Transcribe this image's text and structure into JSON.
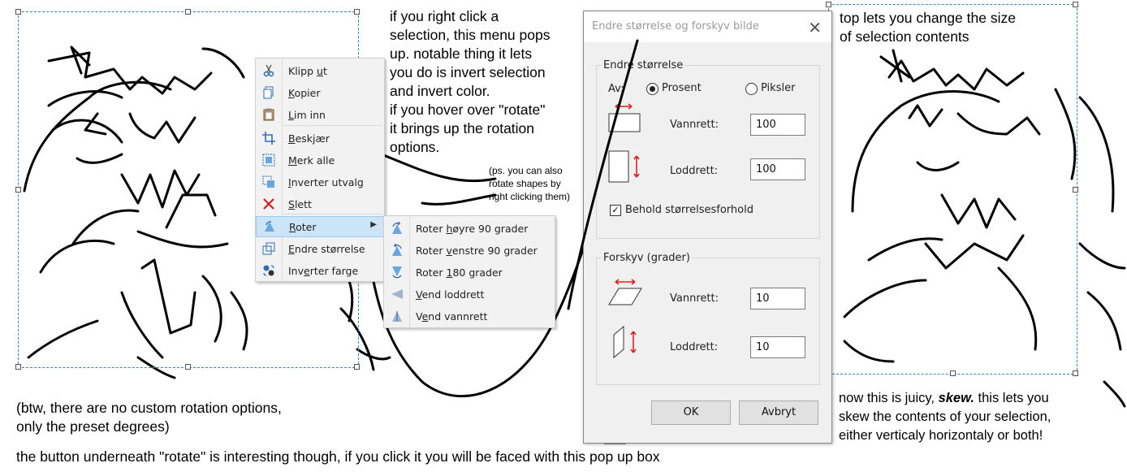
{
  "notes": {
    "right_click": [
      "if you right click a",
      "selection, this menu pops",
      "up. notable thing it lets",
      "you do is invert selection",
      "and invert color.",
      "if you hover over \"rotate\"",
      "it brings up the rotation",
      "options."
    ],
    "ps": [
      "(ps. you can also",
      "rotate shapes by",
      "right clicking them)"
    ],
    "top": [
      "top lets you change the size",
      "of selection contents"
    ],
    "skew_pre": "now this is juicy,",
    "skew_bold": "skew.",
    "skew_post": "this lets you",
    "skew_lines": [
      "skew the contents of your selection,",
      "either verticaly horizontaly or both!"
    ],
    "btw": [
      "(btw, there are no custom rotation options,",
      "only the preset degrees)"
    ],
    "bottom": "the button underneath \"rotate\" is interesting though, if you click it you will be faced with this pop up box"
  },
  "context_menu": {
    "items": [
      {
        "pre": "Klipp ",
        "u": "u",
        "post": "t",
        "icon": "scissors-icon"
      },
      {
        "pre": "",
        "u": "K",
        "post": "opier",
        "icon": "copy-icon"
      },
      {
        "pre": "",
        "u": "L",
        "post": "im inn",
        "icon": "paste-icon"
      },
      {
        "pre": "",
        "u": "B",
        "post": "eskjær",
        "icon": "crop-icon"
      },
      {
        "pre": "",
        "u": "M",
        "post": "erk alle",
        "icon": "select-all-icon"
      },
      {
        "pre": "",
        "u": "I",
        "post": "nverter utvalg",
        "icon": "invert-selection-icon"
      },
      {
        "pre": "",
        "u": "S",
        "post": "lett",
        "icon": "delete-icon"
      },
      {
        "pre": "",
        "u": "R",
        "post": "oter",
        "icon": "rotate-icon"
      },
      {
        "pre": "",
        "u": "E",
        "post": "ndre størrelse",
        "icon": "resize-icon"
      },
      {
        "pre": "Inv",
        "u": "e",
        "post": "rter farge",
        "icon": "invert-color-icon"
      }
    ]
  },
  "submenu": {
    "items": [
      {
        "pre": "Roter ",
        "u": "h",
        "post": "øyre 90 grader",
        "icon": "rotate-right-icon"
      },
      {
        "pre": "Roter ",
        "u": "v",
        "post": "enstre 90 grader",
        "icon": "rotate-left-icon"
      },
      {
        "pre": "Roter ",
        "u": "1",
        "post": "80 grader",
        "icon": "rotate-180-icon"
      },
      {
        "pre": "",
        "u": "V",
        "post": "end loddrett",
        "icon": "flip-vertical-icon"
      },
      {
        "pre": "V",
        "u": "e",
        "post": "nd vannrett",
        "icon": "flip-horizontal-icon"
      }
    ]
  },
  "dialog": {
    "title": "Endre størrelse og forskyv bilde",
    "resize_group": "Endre størrelse",
    "by_label": "Av:",
    "percent_label": "Prosent",
    "pixels_label": "Piksler",
    "horizontal_label": "Vannrett:",
    "vertical_label": "Loddrett:",
    "resize_h": "100",
    "resize_v": "100",
    "keep_ratio_label": "Behold størrelsesforhold",
    "skew_group": "Forskyv (grader)",
    "skew_h": "10",
    "skew_v": "10",
    "ok": "OK",
    "cancel": "Avbryt"
  },
  "colors": {
    "selection_border": "#3a7fbf",
    "menu_highlight": "#cce4f7",
    "arrow_red": "#e02020"
  }
}
